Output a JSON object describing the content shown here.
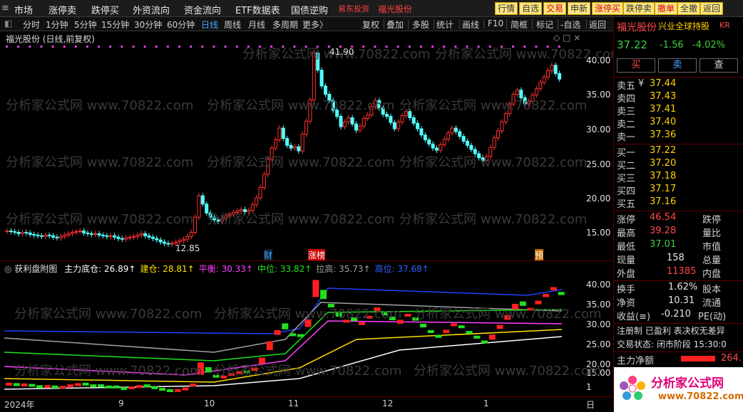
{
  "topmenu": [
    "市场",
    "涨停卖",
    "跌停买",
    "外资流向",
    "资金流向",
    "ETF数据表",
    "国债逆购"
  ],
  "topred": [
    "易东投资",
    "福光股份"
  ],
  "topright": [
    "行情",
    "自选",
    "交易",
    "申新",
    "涨停买",
    "跌停卖",
    "撤单",
    "全撤",
    "返回"
  ],
  "toolbar_left": [
    "分时",
    "1分钟",
    "5分钟",
    "15分钟",
    "30分钟",
    "60分钟",
    "日线",
    "周线",
    "月线",
    "多周期",
    "更多〉"
  ],
  "toolbar_right": [
    "复权",
    "叠加",
    "多股",
    "统计",
    "画线",
    "F10",
    "简框",
    "标记",
    "-自选",
    "返回"
  ],
  "chart_title": "福光股份 (日线,前复权)",
  "high_label": "41.90",
  "low_label": "12.85",
  "y_main": [
    "40.00",
    "35.00",
    "30.00",
    "25.00",
    "20.00",
    "15.00"
  ],
  "events": [
    "财",
    "涨榜",
    "预"
  ],
  "sub": {
    "name": "获利盘附图",
    "items": [
      {
        "label": "主力底仓:",
        "value": "26.89",
        "color": "#ffffff"
      },
      {
        "label": "建仓:",
        "value": "28.81",
        "color": "#ffe000"
      },
      {
        "label": "平衡:",
        "value": "30.33",
        "color": "#ff40ff"
      },
      {
        "label": "中位:",
        "value": "33.82",
        "color": "#20e020"
      },
      {
        "label": "拉高:",
        "value": "35.73",
        "color": "#a0a0a0"
      },
      {
        "label": "高位:",
        "value": "37.68",
        "color": "#3060ff"
      }
    ]
  },
  "y_sub": [
    "40.00",
    "35.00",
    "30.00",
    "25.00",
    "20.00",
    "15.00",
    "1"
  ],
  "dates": [
    "2024年",
    "9",
    "10",
    "11",
    "12",
    "1",
    "日"
  ],
  "watermark": "分析家公式网 www.70822.com",
  "logo": {
    "name": "分析家公式网",
    "url": "www.70822.com"
  },
  "quote": {
    "name": "福光股份",
    "tag": "兴业全球持股",
    "kr": "KR",
    "price": "37.22",
    "chg": "-1.56",
    "pct": "-4.02%",
    "buy": "买",
    "sell": "卖",
    "check": "查",
    "asks": [
      {
        "l": "卖五",
        "v": "37.44"
      },
      {
        "l": "卖四",
        "v": "37.43"
      },
      {
        "l": "卖三",
        "v": "37.41"
      },
      {
        "l": "卖二",
        "v": "37.40"
      },
      {
        "l": "卖一",
        "v": "37.36"
      }
    ],
    "bids": [
      {
        "l": "买一",
        "v": "37.22"
      },
      {
        "l": "买二",
        "v": "37.20"
      },
      {
        "l": "买三",
        "v": "37.18"
      },
      {
        "l": "买四",
        "v": "37.17"
      },
      {
        "l": "买五",
        "v": "37.16"
      }
    ],
    "ask_mark": "¥",
    "stats": [
      {
        "l": "涨停",
        "v": "46.54",
        "c": "r",
        "l2": "跌停"
      },
      {
        "l": "最高",
        "v": "39.28",
        "c": "r",
        "l2": "量比"
      },
      {
        "l": "最低",
        "v": "37.01",
        "c": "g",
        "l2": "市值"
      },
      {
        "l": "现量",
        "v": "158",
        "c": "w",
        "l2": "总量"
      },
      {
        "l": "外盘",
        "v": "11385",
        "c": "r",
        "l2": "内盘"
      }
    ],
    "stats2": [
      {
        "l": "换手",
        "v": "1.62%",
        "l2": "股本"
      },
      {
        "l": "净资",
        "v": "10.31",
        "l2": "流通"
      },
      {
        "l": "收益(≡)",
        "v": "-0.210",
        "l2": "PE(动)"
      }
    ],
    "status1": "注册制 已盈利 表决权无差异",
    "status2": "交易状态: 闭市阶段 15:30:0",
    "netflow_label": "主力净额",
    "netflow_value": "264."
  },
  "chart_data": {
    "type": "candlestick",
    "title": "福光股份 (日线,前复权)",
    "y_range": [
      12,
      42
    ],
    "high": 41.9,
    "low": 12.85,
    "period": "2024年 to 1"
  }
}
